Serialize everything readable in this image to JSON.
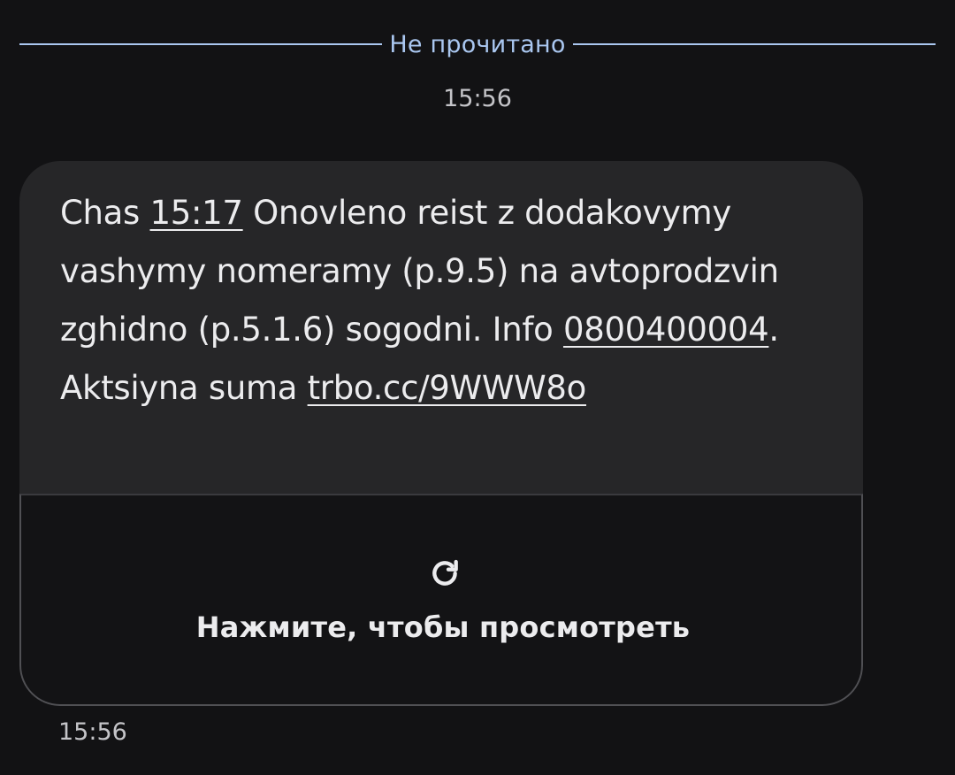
{
  "divider": {
    "label": "Не прочитано",
    "color": "#aac7f0"
  },
  "timestamp_top": "15:56",
  "message": {
    "segments": [
      {
        "text": "Chas ",
        "link": false
      },
      {
        "text": "15:17",
        "link": true
      },
      {
        "text": " Onovleno reist z dodakovymy vashymy nomeramy (p.9.5) na avtoprodzvin zghidno (p.5.1.6) sogodni. Info ",
        "link": false
      },
      {
        "text": "0800400004",
        "link": true
      },
      {
        "text": ". Aktsiyna suma ",
        "link": false
      },
      {
        "text": "trbo.cc/​9WWW8o",
        "link": true
      }
    ],
    "preview": {
      "icon": "refresh-icon",
      "label": "Нажмите, чтобы просмотреть"
    }
  },
  "timestamp_bottom": "15:56",
  "colors": {
    "background": "#121214",
    "bubble": "#262628",
    "accent": "#aac7f0"
  }
}
